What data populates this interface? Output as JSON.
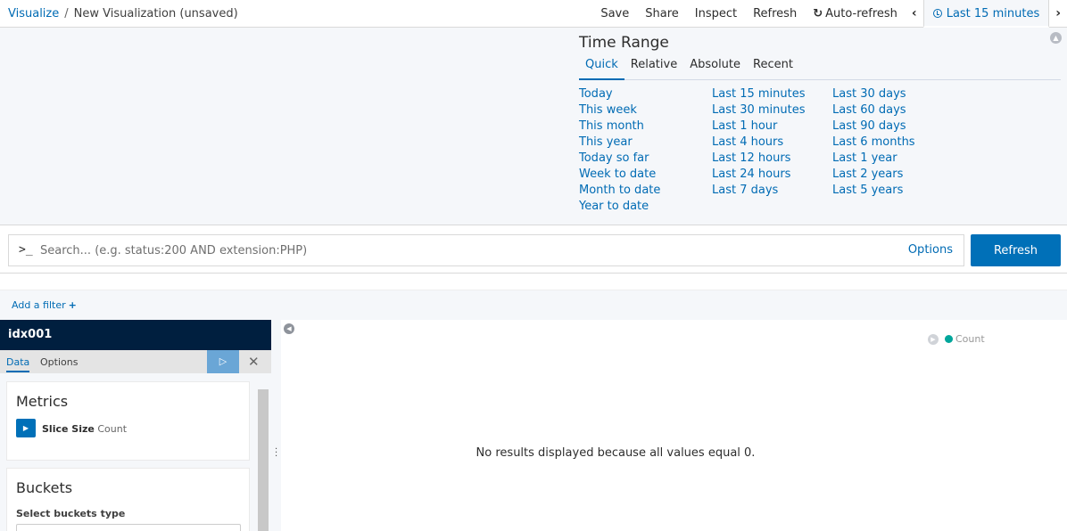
{
  "breadcrumb": {
    "root": "Visualize",
    "separator": "/",
    "current": "New Visualization (unsaved)"
  },
  "top_menu": {
    "save": "Save",
    "share": "Share",
    "inspect": "Inspect",
    "refresh": "Refresh",
    "auto_refresh": "Auto-refresh",
    "prev_icon": "chevron-left-icon",
    "time_label": "Last 15 minutes",
    "next_icon": "chevron-right-icon"
  },
  "time_range": {
    "title": "Time Range",
    "tabs": [
      "Quick",
      "Relative",
      "Absolute",
      "Recent"
    ],
    "active_tab": "Quick",
    "columns": [
      [
        "Today",
        "This week",
        "This month",
        "This year",
        "Today so far",
        "Week to date",
        "Month to date",
        "Year to date"
      ],
      [
        "Last 15 minutes",
        "Last 30 minutes",
        "Last 1 hour",
        "Last 4 hours",
        "Last 12 hours",
        "Last 24 hours",
        "Last 7 days"
      ],
      [
        "Last 30 days",
        "Last 60 days",
        "Last 90 days",
        "Last 6 months",
        "Last 1 year",
        "Last 2 years",
        "Last 5 years"
      ]
    ]
  },
  "search": {
    "prompt": ">_",
    "placeholder": "Search... (e.g. status:200 AND extension:PHP)",
    "options": "Options",
    "refresh_button": "Refresh"
  },
  "filter": {
    "add_filter": "Add a filter",
    "plus": "+"
  },
  "sidebar": {
    "index": "idx001",
    "tabs": [
      "Data",
      "Options"
    ],
    "active_tab": "Data",
    "metrics": {
      "title": "Metrics",
      "agg_label": "Slice Size",
      "agg_value": "Count"
    },
    "buckets": {
      "title": "Buckets",
      "select_label": "Select buckets type"
    }
  },
  "main": {
    "legend": {
      "label": "Count",
      "color": "#00a69b"
    },
    "message": "No results displayed because all values equal 0."
  },
  "colors": {
    "accent": "#006bb4",
    "primary_button": "#0070b8",
    "dark_header": "#001f3f"
  }
}
